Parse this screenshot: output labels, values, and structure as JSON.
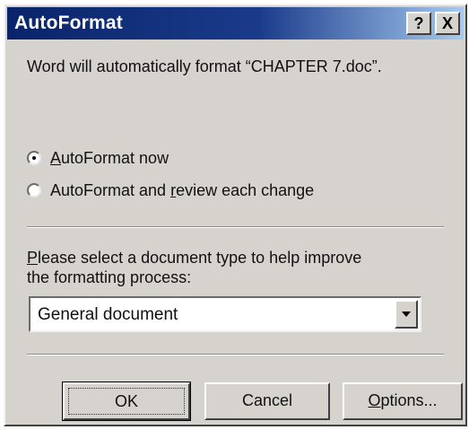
{
  "dialog": {
    "title": "AutoFormat",
    "help_button": "?",
    "close_button": "X",
    "message": "Word will automatically format “CHAPTER 7.doc”.",
    "options": [
      {
        "prefix": "",
        "accel": "A",
        "rest": "utoFormat now",
        "checked": true
      },
      {
        "prefix": "AutoFormat and ",
        "accel": "r",
        "rest": "eview each change",
        "checked": false
      }
    ],
    "prompt": {
      "accel": "P",
      "line1_rest": "lease select a document type to help improve",
      "line2": "the formatting process:"
    },
    "doc_type": {
      "selected": "General document"
    },
    "buttons": {
      "ok": "OK",
      "cancel": "Cancel",
      "options_accel": "O",
      "options_rest": "ptions..."
    }
  }
}
